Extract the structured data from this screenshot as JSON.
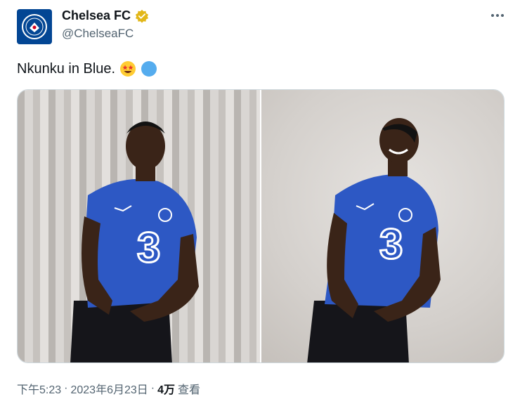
{
  "author": {
    "name": "Chelsea FC",
    "handle": "@ChelseaFC",
    "avatar_text": "CHELSEA FOOTBALL CLUB"
  },
  "tweet": {
    "text": "Nkunku in Blue."
  },
  "photos": [
    {
      "alt": "",
      "jersey_sponsor": "3"
    },
    {
      "alt": "",
      "jersey_sponsor": "3"
    }
  ],
  "meta": {
    "time": "下午5:23",
    "separator1": "·",
    "date": "2023年6月23日",
    "separator2": "·",
    "views_count": "4万",
    "views_label": "查看"
  },
  "colors": {
    "brand_blue": "#034694",
    "verified_gold": "#e2b719",
    "jersey_blue": "#2d58c4"
  },
  "icons": [
    "more-icon",
    "verified-badge-icon",
    "star-struck-emoji-icon",
    "blue-circle-emoji-icon"
  ]
}
